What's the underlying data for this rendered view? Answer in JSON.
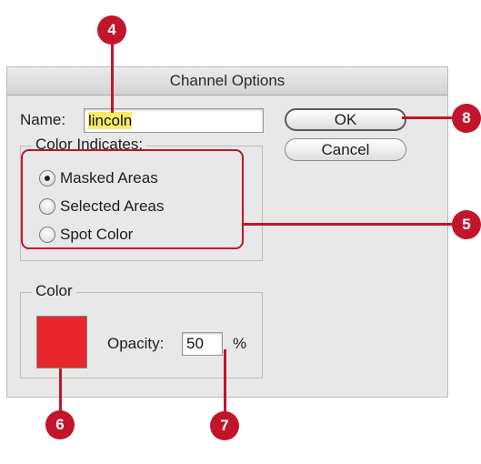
{
  "dialog": {
    "title": "Channel Options",
    "name_label": "Name:",
    "name_value": "lincoln",
    "ok_label": "OK",
    "cancel_label": "Cancel",
    "color_indicates": {
      "title": "Color Indicates:",
      "options": [
        {
          "label": "Masked Areas",
          "checked": true
        },
        {
          "label": "Selected Areas",
          "checked": false
        },
        {
          "label": "Spot Color",
          "checked": false
        }
      ]
    },
    "color_group": {
      "title": "Color",
      "swatch_color": "#e8262b",
      "opacity_label": "Opacity:",
      "opacity_value": "50",
      "opacity_unit": "%"
    }
  },
  "callouts": {
    "name": "4",
    "radios": "5",
    "swatch": "6",
    "opacity": "7",
    "ok": "8"
  },
  "colors": {
    "callout_red": "#c2152b",
    "selection_highlight": "#f7ec6a"
  }
}
